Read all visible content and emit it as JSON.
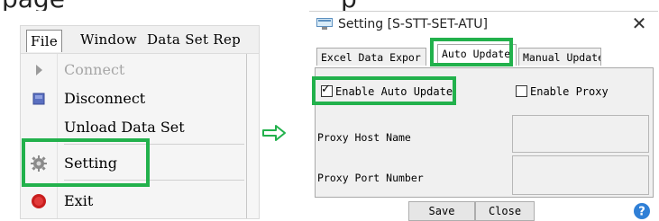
{
  "file_menu": {
    "menubar": {
      "file": "File",
      "window": "Window",
      "dataset": "Data Set Rep"
    },
    "items": [
      {
        "label": "Connect",
        "icon": "connect-icon",
        "enabled": false
      },
      {
        "label": "Disconnect",
        "icon": "disconnect-icon",
        "enabled": true
      },
      {
        "label": "Unload Data Set",
        "icon": "",
        "enabled": true
      },
      {
        "label": "Setting",
        "icon": "gear-icon",
        "enabled": true,
        "highlighted": true
      },
      {
        "label": "Exit",
        "icon": "exit-icon",
        "enabled": true
      }
    ]
  },
  "arrow_icon": "right-arrow-icon",
  "dialog": {
    "title": "Setting [S-STT-SET-ATU]",
    "close_glyph": "✕",
    "tabs": [
      {
        "label": "Excel Data Expor",
        "active": false
      },
      {
        "label": "Auto Update",
        "active": true,
        "highlighted": true
      },
      {
        "label": "Manual Update",
        "active": false
      }
    ],
    "enable_auto_update": {
      "label": "Enable Auto Update",
      "checked": true,
      "highlighted": true
    },
    "enable_proxy": {
      "label": "Enable Proxy",
      "checked": false
    },
    "proxy_host": {
      "label": "Proxy Host Name",
      "value": ""
    },
    "proxy_port": {
      "label": "Proxy Port Number",
      "value": ""
    },
    "buttons": {
      "save": "Save",
      "close": "Close"
    },
    "help_icon": "question-icon"
  },
  "colors": {
    "highlight": "#22b14c",
    "arrow": "#22b14c",
    "help": "#2f7fd6"
  }
}
